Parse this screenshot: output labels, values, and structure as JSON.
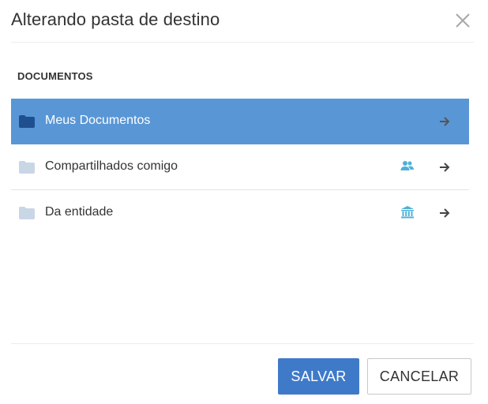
{
  "dialog": {
    "title": "Alterando pasta de destino",
    "section_label": "DOCUMENTOS"
  },
  "folders": [
    {
      "label": "Meus Documentos",
      "selected": true,
      "type_icon": "none",
      "arrow_icon": "arrow-right-icon"
    },
    {
      "label": "Compartilhados comigo",
      "selected": false,
      "type_icon": "people-icon",
      "arrow_icon": "arrow-right-icon"
    },
    {
      "label": "Da entidade",
      "selected": false,
      "type_icon": "institution-icon",
      "arrow_icon": "arrow-right-icon"
    }
  ],
  "footer": {
    "save_label": "SALVAR",
    "cancel_label": "CANCELAR"
  },
  "colors": {
    "selected_row": "#5996d6",
    "folder_selected": "#1f4f8f",
    "folder_default": "#c9d6e6",
    "type_icon": "#4fb0d8",
    "save_button": "#3f7ac9"
  }
}
